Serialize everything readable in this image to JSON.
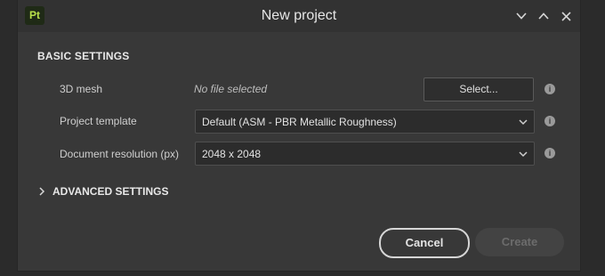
{
  "window": {
    "app_logo": "Pt",
    "title": "New project",
    "controls": [
      "chevron-down-icon",
      "chevron-up-icon",
      "close-icon"
    ]
  },
  "basic_settings": {
    "heading": "BASIC SETTINGS",
    "mesh": {
      "label": "3D mesh",
      "value": "No file selected",
      "button_label": "Select..."
    },
    "template": {
      "label": "Project template",
      "selected": "Default (ASM - PBR Metallic Roughness)"
    },
    "resolution": {
      "label": "Document resolution (px)",
      "selected": "2048 x 2048"
    }
  },
  "advanced_settings": {
    "heading": "ADVANCED SETTINGS",
    "expanded": false
  },
  "footer": {
    "cancel_label": "Cancel",
    "create_label": "Create",
    "create_enabled": false
  },
  "colors": {
    "accent_logo": "#b8e04a",
    "dialog_bg": "#383838"
  }
}
